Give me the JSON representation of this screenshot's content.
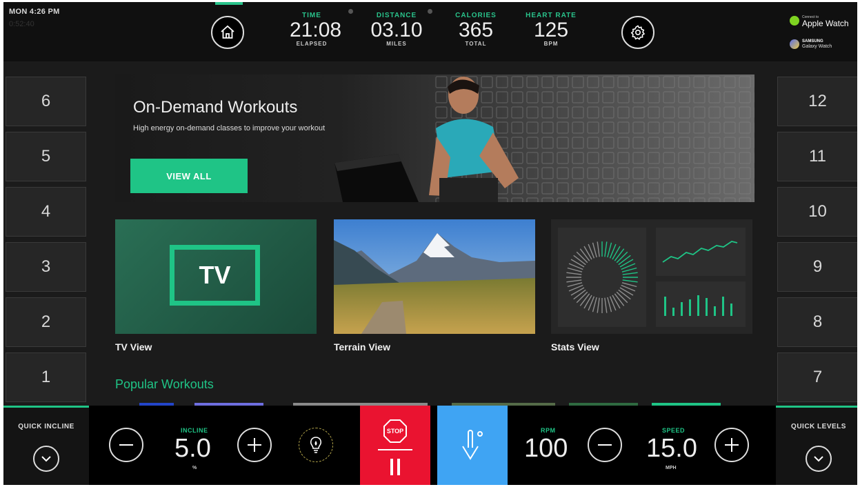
{
  "status": {
    "clock": "MON 4:26 PM",
    "sub": "0:52:40"
  },
  "metrics": [
    {
      "label": "TIME",
      "value": "21:08",
      "unit": "ELAPSED"
    },
    {
      "label": "DISTANCE",
      "value": "03.10",
      "unit": "MILES"
    },
    {
      "label": "CALORIES",
      "value": "365",
      "unit": "TOTAL"
    },
    {
      "label": "HEART RATE",
      "value": "125",
      "unit": "BPM"
    }
  ],
  "watches": {
    "apple": {
      "small": "Connect to",
      "name": "Apple Watch",
      "color": "#7ed321"
    },
    "samsung": {
      "small": "SAMSUNG",
      "name": "Galaxy Watch",
      "color": "#5a6ee8"
    }
  },
  "incline_levels": [
    "6",
    "5",
    "4",
    "3",
    "2",
    "1"
  ],
  "speed_levels": [
    "12",
    "11",
    "10",
    "9",
    "8",
    "7"
  ],
  "hero": {
    "title": "On-Demand Workouts",
    "subtitle": "High energy on-demand classes to improve your workout",
    "button": "VIEW ALL"
  },
  "tiles": [
    {
      "label": "TV View",
      "badge": "TV"
    },
    {
      "label": "Terrain View"
    },
    {
      "label": "Stats View"
    }
  ],
  "popular_title": "Popular Workouts",
  "controls": {
    "quick_incline": "QUICK INCLINE",
    "quick_levels": "QUICK LEVELS",
    "incline": {
      "label": "INCLINE",
      "value": "5.0",
      "unit": "%"
    },
    "rpm": {
      "label": "RPM",
      "value": "100"
    },
    "speed": {
      "label": "SPEED",
      "value": "15.0",
      "unit": "MPH"
    },
    "stop_label": "STOP"
  },
  "colors": {
    "accent": "#1fc486",
    "stop": "#ea1330",
    "cooldown": "#3fa4f3"
  },
  "icons": [
    "home-icon",
    "gear-icon",
    "lightbulb-icon",
    "stop-sign-icon",
    "pause-icon",
    "thermometer-down-icon",
    "chevron-down-icon",
    "minus-icon",
    "plus-icon"
  ]
}
